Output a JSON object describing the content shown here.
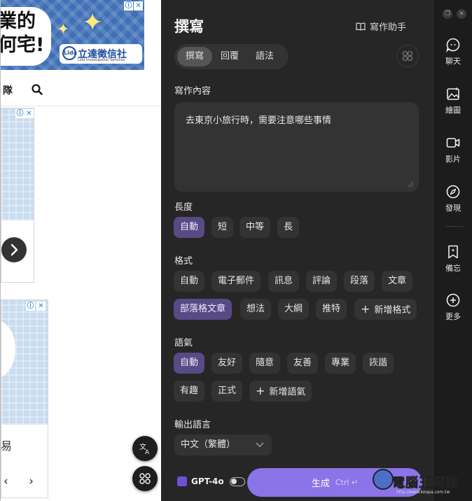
{
  "background_page": {
    "ad_top": {
      "text": "業的\n何宅!",
      "logo": "立達徵信社",
      "logo_mark": "Lida",
      "logo_sub": "Lida Investigation Services"
    },
    "nav_text": "隊",
    "partial_text": "易",
    "pager": "‹ ›"
  },
  "panel": {
    "title": "撰寫",
    "assistant_label": "寫作助手",
    "tabs": [
      "撰寫",
      "回覆",
      "語法"
    ],
    "content_label": "寫作內容",
    "content_text": "去東京小旅行時，需要注意哪些事情",
    "length": {
      "label": "長度",
      "options": [
        "自動",
        "短",
        "中等",
        "長"
      ],
      "selected": "自動"
    },
    "format": {
      "label": "格式",
      "options": [
        "自動",
        "電子郵件",
        "訊息",
        "評論",
        "段落",
        "文章",
        "部落格文章",
        "想法",
        "大綱",
        "推特"
      ],
      "add_label": "新增格式",
      "selected": "部落格文章"
    },
    "tone": {
      "label": "語氣",
      "options": [
        "自動",
        "友好",
        "隨意",
        "友善",
        "專業",
        "詼諧",
        "有趣",
        "正式"
      ],
      "add_label": "新增語氣",
      "selected": "自動"
    },
    "language": {
      "label": "輸出語言",
      "value": "中文（繁體）"
    },
    "model": "GPT-4o",
    "generate_label": "生成",
    "generate_shortcut": "Ctrl ↵"
  },
  "rail": {
    "items": [
      "聊天",
      "繪圖",
      "影片",
      "發現",
      "備忘",
      "更多"
    ]
  },
  "watermark": {
    "text": "電腦王阿達",
    "url": "http://www.koopa.com.tw"
  },
  "colors": {
    "panel_bg": "#262626",
    "rail_bg": "#1c1c1c",
    "chip_bg": "#333333",
    "selected_chip": "#574a85",
    "generate": "#8a74e8"
  }
}
